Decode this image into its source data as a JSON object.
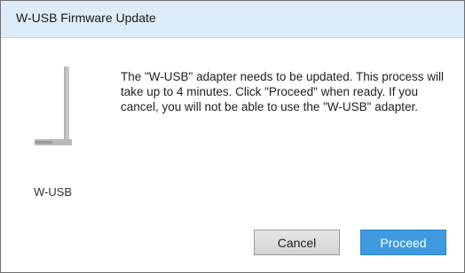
{
  "window": {
    "title": "W-USB Firmware Update"
  },
  "device": {
    "label": "W-USB",
    "icon": "usb-adapter-icon"
  },
  "message": {
    "text": "The \"W-USB\" adapter needs to be updated. This process will take up to 4 minutes. Click \"Proceed\" when ready. If you cancel, you will not be able to use the \"W-USB\" adapter."
  },
  "buttons": {
    "cancel_label": "Cancel",
    "proceed_label": "Proceed"
  },
  "colors": {
    "titlebar": "#dcecf8",
    "accent": "#3f9adf"
  }
}
